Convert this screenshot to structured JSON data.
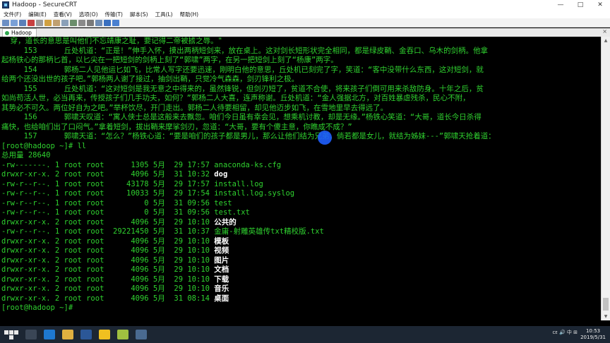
{
  "window": {
    "title": "Hadoop - SecureCRT",
    "controls": [
      "—",
      "□",
      "✕"
    ]
  },
  "menu": [
    "文件(F)",
    "编辑(E)",
    "查看(V)",
    "选项(O)",
    "传输(T)",
    "脚本(S)",
    "工具(L)",
    "帮助(H)"
  ],
  "tab": {
    "label": "Hadoop",
    "close": "×"
  },
  "terminal": {
    "text_lines": [
      "  穿，道长的意思是叫他们不忘靖康之耻，要记得二帝被掳之辱。\"",
      "     153      丘处机道：“正是！”伸手入怀，摸出两柄短剑来，放在桌上。这对剑长短形状完全相同，都是绿皮鞘、金吞口、乌木的剑柄。他拿",
      "起杨铁心的那柄匕首，以匕尖在一把短剑的剑柄上刻了“郭啸”两字，在另一把短剑上刻了“杨康”两字。",
      "     154      郭杨二人见他运匕如飞，比常人写字还要迅速，刚明白他的意思，丘处机已刻完了字，笑道：“客中没带什么东西，这对短剑，就",
      "给两个还没出世的孩子吧。”郭杨两人谢了接过，抽剑出鞘，只觉冷气森森，剑刃锋利之极。",
      "     155      丘处机道：“这对短剑是我无意之中得来的，虽然锋锐，但剑刃短了，贫道不合使，将来孩子们倒可用来杀敌防身。十年之后，贫",
      "如尚苟活人世，必当再来，传授孩子们几手功夫，如何？”郭杨二人大喜，连声称谢。丘处机道：“金人强据北方，对百姓暴虐残杀，民心不附，",
      "其势必不可久。两位好自为之吧。”举杯饮尽，开门走出。郭杨二人待要相留，却见他迈步如飞，在雪地里早去得远了。",
      "     156      郭啸天叹道：“寓人侠士总是这般来去飘忽。咱们今日虽有幸会见，想乘机讨教，却是无缘。”杨铁心笑道：“大哥，道长今日杀得",
      "痛快，也给咱们出了口闷气。”拿着短剑，拔出鞘来摩挲剑刃，忽道：“大哥，要有个傻主意，你瞧成不成？”",
      "     157      郭啸天道：“怎么？”杨铁心道：“要是咱们的孩子都是男儿，那么让他们结为兄弟，倘若都是女儿，就结为姊妹---”郭啸天抢着道：",
      "[root@hadoop ~]# ll",
      "总用量 28640"
    ],
    "listing": [
      {
        "perm": "-rw-------.",
        "links": "1",
        "owner": "root",
        "group": "root",
        "size": "1305",
        "month": "5月",
        "day": "29",
        "time": "17:57",
        "name": "anaconda-ks.cfg",
        "dir": false
      },
      {
        "perm": "drwxr-xr-x.",
        "links": "2",
        "owner": "root",
        "group": "root",
        "size": "4096",
        "month": "5月",
        "day": "31",
        "time": "10:32",
        "name": "dog",
        "dir": true
      },
      {
        "perm": "-rw-r--r--.",
        "links": "1",
        "owner": "root",
        "group": "root",
        "size": "43178",
        "month": "5月",
        "day": "29",
        "time": "17:57",
        "name": "install.log",
        "dir": false
      },
      {
        "perm": "-rw-r--r--.",
        "links": "1",
        "owner": "root",
        "group": "root",
        "size": "10033",
        "month": "5月",
        "day": "29",
        "time": "17:54",
        "name": "install.log.syslog",
        "dir": false
      },
      {
        "perm": "-rw-r--r--.",
        "links": "1",
        "owner": "root",
        "group": "root",
        "size": "0",
        "month": "5月",
        "day": "31",
        "time": "09:56",
        "name": "test",
        "dir": false
      },
      {
        "perm": "-rw-r--r--.",
        "links": "1",
        "owner": "root",
        "group": "root",
        "size": "0",
        "month": "5月",
        "day": "31",
        "time": "09:56",
        "name": "test.txt",
        "dir": false
      },
      {
        "perm": "drwxr-xr-x.",
        "links": "2",
        "owner": "root",
        "group": "root",
        "size": "4096",
        "month": "5月",
        "day": "29",
        "time": "10:10",
        "name": "公共的",
        "dir": true
      },
      {
        "perm": "-rw-r--r--.",
        "links": "1",
        "owner": "root",
        "group": "root",
        "size": "29221450",
        "month": "5月",
        "day": "31",
        "time": "10:37",
        "name": "金庸-射雕英雄传txt精校版.txt",
        "dir": false
      },
      {
        "perm": "drwxr-xr-x.",
        "links": "2",
        "owner": "root",
        "group": "root",
        "size": "4096",
        "month": "5月",
        "day": "29",
        "time": "10:10",
        "name": "模板",
        "dir": true
      },
      {
        "perm": "drwxr-xr-x.",
        "links": "2",
        "owner": "root",
        "group": "root",
        "size": "4096",
        "month": "5月",
        "day": "29",
        "time": "10:10",
        "name": "视频",
        "dir": true
      },
      {
        "perm": "drwxr-xr-x.",
        "links": "2",
        "owner": "root",
        "group": "root",
        "size": "4096",
        "month": "5月",
        "day": "29",
        "time": "10:10",
        "name": "图片",
        "dir": true
      },
      {
        "perm": "drwxr-xr-x.",
        "links": "2",
        "owner": "root",
        "group": "root",
        "size": "4096",
        "month": "5月",
        "day": "29",
        "time": "10:10",
        "name": "文档",
        "dir": true
      },
      {
        "perm": "drwxr-xr-x.",
        "links": "2",
        "owner": "root",
        "group": "root",
        "size": "4096",
        "month": "5月",
        "day": "29",
        "time": "10:10",
        "name": "下载",
        "dir": true
      },
      {
        "perm": "drwxr-xr-x.",
        "links": "2",
        "owner": "root",
        "group": "root",
        "size": "4096",
        "month": "5月",
        "day": "29",
        "time": "10:10",
        "name": "音乐",
        "dir": true
      },
      {
        "perm": "drwxr-xr-x.",
        "links": "2",
        "owner": "root",
        "group": "root",
        "size": "4096",
        "month": "5月",
        "day": "31",
        "time": "08:14",
        "name": "桌面",
        "dir": true
      }
    ],
    "final_prompt": "[root@hadoop ~]#",
    "colors": {
      "text": "#2fd12f",
      "dir": "#ffffff",
      "background": "#000000"
    }
  },
  "taskbar": {
    "icons": [
      "start-icon",
      "task-view-icon",
      "edge-icon",
      "file-explorer-icon",
      "word-icon",
      "app-icon",
      "app-icon",
      "securecrt-icon"
    ],
    "tray": "ᴄᴇ 🔊 中 ⊞",
    "time": "10:53",
    "date": "2019/5/31"
  }
}
